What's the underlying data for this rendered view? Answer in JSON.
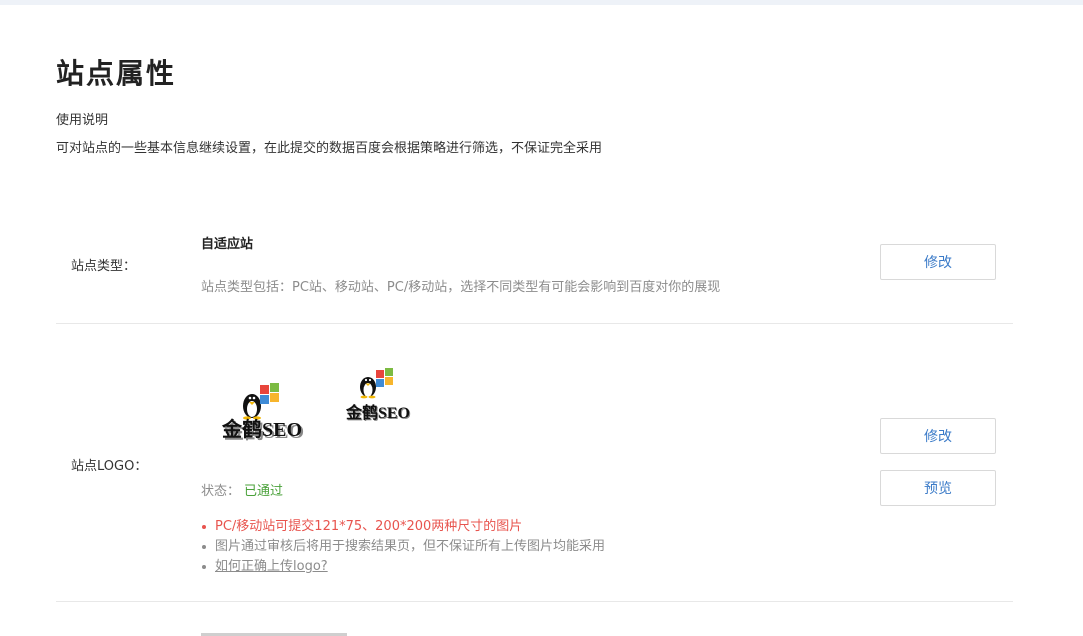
{
  "page": {
    "title": "站点属性",
    "usage_heading": "使用说明",
    "usage_desc": "可对站点的一些基本信息继续设置，在此提交的数据百度会根据策略进行筛选，不保证完全采用"
  },
  "site_type": {
    "label": "站点类型：",
    "value": "自适应站",
    "desc": "站点类型包括：PC站、移动站、PC/移动站，选择不同类型有可能会影响到百度对你的展现",
    "edit_label": "修改"
  },
  "site_logo": {
    "label": "站点LOGO：",
    "logo_text": "金鹤SEO",
    "status_label": "状态：",
    "status_value": "已通过",
    "edit_label": "修改",
    "preview_label": "预览",
    "notes": [
      "PC/移动站可提交121*75、200*200两种尺寸的图片",
      "图片通过审核后将用于搜索结果页，但不保证所有上传图片均能采用"
    ],
    "help_link": "如何正确上传logo?"
  },
  "colors": {
    "accent_link": "#3b7bc8",
    "status_ok": "#4aa13a",
    "note_warning": "#e8544e"
  }
}
